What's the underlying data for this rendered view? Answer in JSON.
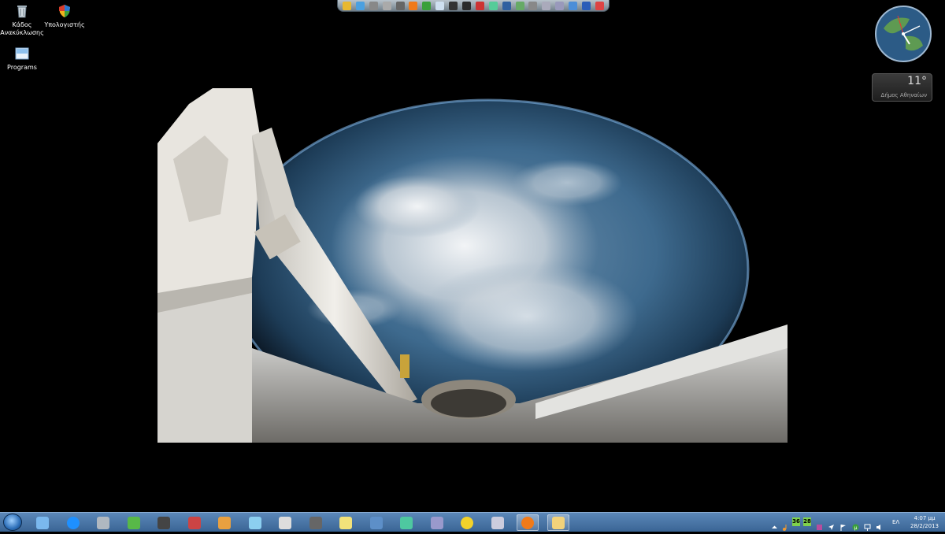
{
  "desktop": {
    "icons": [
      {
        "label": "Κάδος Ανακύκλωσης",
        "icon": "recycle-bin-icon"
      },
      {
        "label": "Υπολογιστής",
        "icon": "computer-shield-icon"
      },
      {
        "label": "Programs",
        "icon": "folder-icon"
      }
    ]
  },
  "dock": {
    "items": [
      "shield-icon",
      "network-icon",
      "printer-icon",
      "pc-icon",
      "bars-icon",
      "firefox-icon",
      "utorrent-icon",
      "document-icon",
      "cd-icon",
      "chess-icon",
      "audio-icon",
      "paint-icon",
      "monitor-icon",
      "media-icon",
      "tools-icon",
      "mail-icon",
      "settings-icon",
      "globe-icon",
      "bluetooth-icon",
      "stop-icon"
    ]
  },
  "gadgets": {
    "weather": {
      "temp": "11°",
      "location": "Δήμος Αθηναίων"
    }
  },
  "taskbar": {
    "pinned": [
      "explorer-icon",
      "ie-icon",
      "grid-icon",
      "media-center-icon",
      "cmd-icon",
      "rocket-icon",
      "paint-palette-icon",
      "notepad-icon",
      "calculator-icon",
      "pen-icon",
      "sticky-notes-icon",
      "remote-desktop-icon",
      "cube-icon",
      "teapot-icon",
      "x-tool-icon",
      "chat-icon",
      "firefox-icon",
      "folder-icon"
    ],
    "active_index": 16,
    "tray": {
      "num1": "36",
      "num2": "28",
      "lang": "ΕΛ",
      "time": "4:07 μμ",
      "date": "28/2/2013"
    }
  }
}
